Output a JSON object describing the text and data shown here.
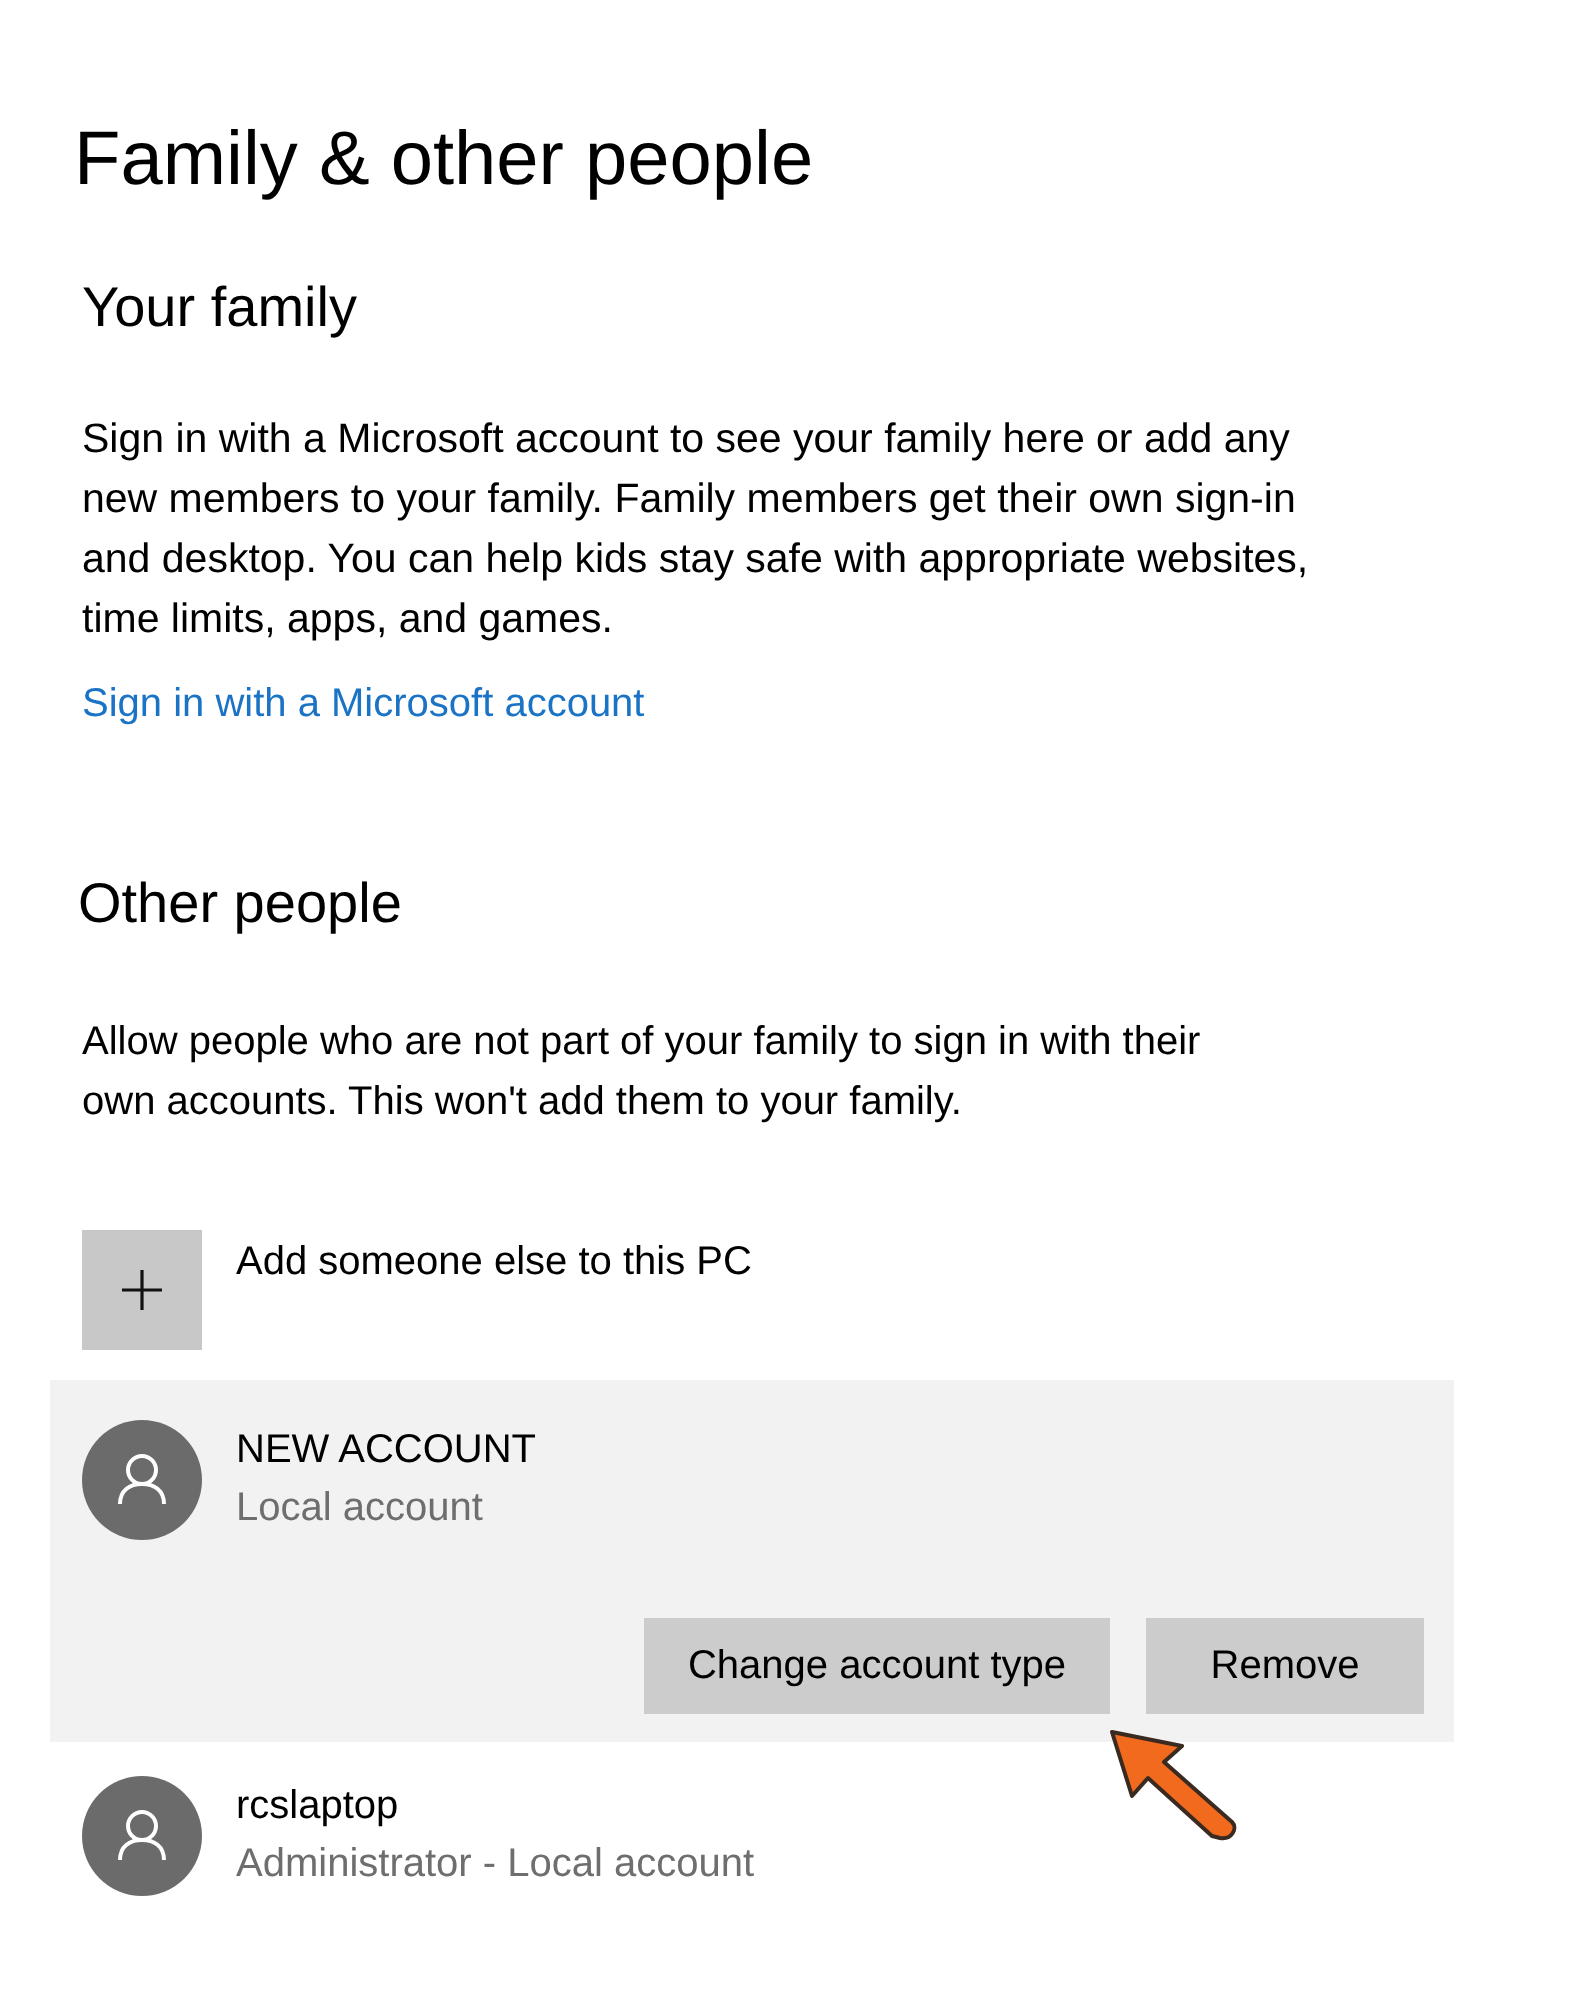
{
  "page": {
    "title": "Family & other people"
  },
  "your_family": {
    "heading": "Your family",
    "description": "Sign in with a Microsoft account to see your family here or add any new members to your family. Family members get their own sign-in and desktop. You can help kids stay safe with appropriate websites, time limits, apps, and games.",
    "link": "Sign in with a Microsoft account"
  },
  "other_people": {
    "heading": "Other people",
    "description": "Allow people who are not part of your family to sign in with their own accounts. This won't add them to your family.",
    "add_button": "Add someone else to this PC",
    "accounts": [
      {
        "name": "NEW ACCOUNT",
        "type": "Local account",
        "selected": true,
        "buttons": [
          "Change account type",
          "Remove"
        ]
      },
      {
        "name": "rcslaptop",
        "type": "Administrator - Local account",
        "selected": false
      }
    ]
  }
}
